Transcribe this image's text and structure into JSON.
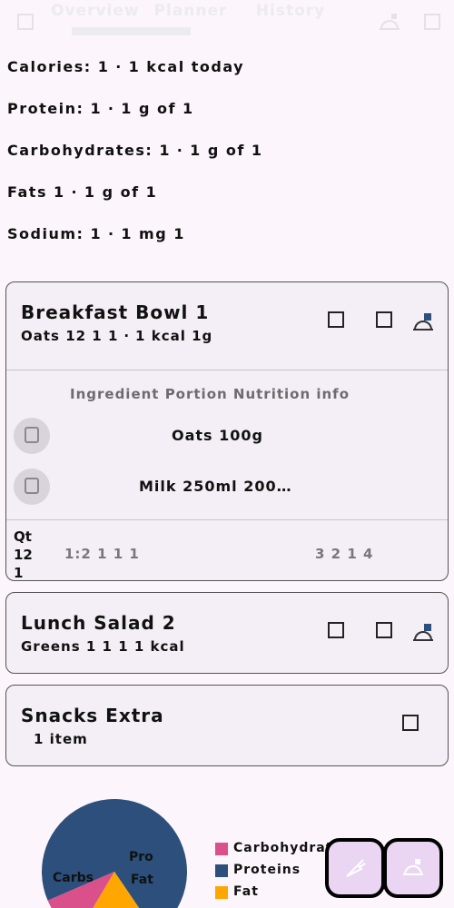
{
  "topbar": {
    "tabs": [
      "Overview",
      "Planner",
      "History"
    ]
  },
  "stats": [
    "Calories: 1 ‧ 1 kcal today",
    "Protein: 1 ‧ 1 g of 1",
    "Carbohydrates: 1 ‧ 1 g of 1",
    "Fats 1 ‧ 1 g of 1",
    "Sodium: 1 ‧ 1 mg 1"
  ],
  "cards": [
    {
      "title": "Breakfast Bowl 1",
      "subtitle": "Oats 12 1  1 ‧ 1 kcal 1g",
      "detail_header": "Ingredient Portion  Nutrition info",
      "rows": [
        "Oats 100g",
        "Milk 250ml 200…"
      ],
      "foot_label": "Qt 12 1",
      "foot_vals": "1:2 1  1 1",
      "foot_right": "3 2 1 4"
    },
    {
      "title": "Lunch Salad 2",
      "subtitle": "Greens 1 1  1 1 kcal"
    },
    {
      "title": "Snacks Extra",
      "subtitle": "1 item"
    }
  ],
  "chart_data": {
    "type": "pie",
    "categories": [
      "Carbohydrates",
      "Protein",
      "Fat"
    ],
    "values": [
      72,
      18,
      10
    ],
    "colors": [
      "#2c4f7c",
      "#ffa600",
      "#d9508a"
    ],
    "slice_labels": [
      "Carbs",
      "Pro",
      "Fat"
    ],
    "legend": [
      "Carbohydrates",
      "Proteins",
      "Fat"
    ]
  },
  "icons": {
    "fab1": "carrot-icon",
    "fab2": "dish-icon"
  }
}
